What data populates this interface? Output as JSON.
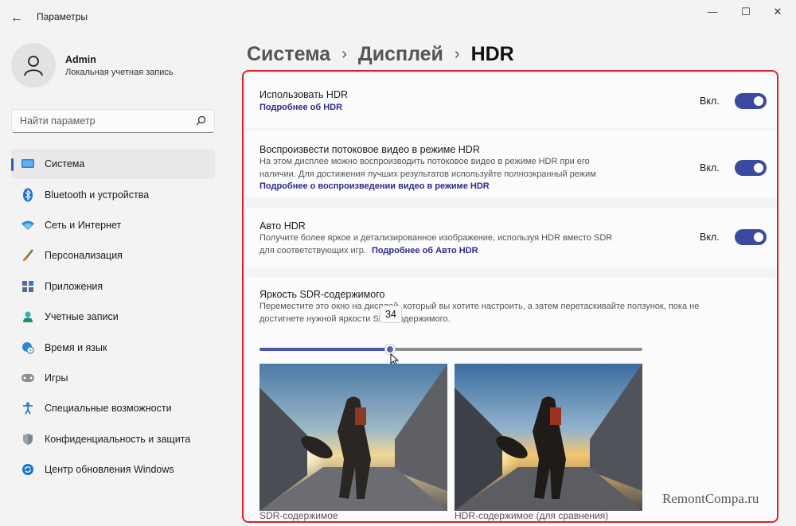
{
  "window": {
    "title": "Параметры",
    "back_icon": "arrow-left-icon",
    "controls": {
      "minimize": "—",
      "maximize": "☐",
      "close": "✕"
    }
  },
  "user": {
    "name": "Admin",
    "account_type": "Локальная учетная запись"
  },
  "search": {
    "placeholder": "Найти параметр"
  },
  "sidebar": {
    "items": [
      {
        "label": "Система",
        "icon": "display-icon",
        "active": true
      },
      {
        "label": "Bluetooth и устройства",
        "icon": "bluetooth-icon"
      },
      {
        "label": "Сеть и Интернет",
        "icon": "wifi-icon"
      },
      {
        "label": "Персонализация",
        "icon": "brush-icon"
      },
      {
        "label": "Приложения",
        "icon": "apps-icon"
      },
      {
        "label": "Учетные записи",
        "icon": "person-icon"
      },
      {
        "label": "Время и язык",
        "icon": "globe-clock-icon"
      },
      {
        "label": "Игры",
        "icon": "gamepad-icon"
      },
      {
        "label": "Специальные возможности",
        "icon": "accessibility-icon"
      },
      {
        "label": "Конфиденциальность и защита",
        "icon": "shield-icon"
      },
      {
        "label": "Центр обновления Windows",
        "icon": "update-icon"
      }
    ]
  },
  "breadcrumb": {
    "parts": [
      "Система",
      "Дисплей"
    ],
    "separator": "›",
    "current": "HDR"
  },
  "settings": {
    "use_hdr": {
      "title": "Использовать HDR",
      "link": "Подробнее об HDR",
      "state": "Вкл.",
      "on": true
    },
    "stream_hdr": {
      "title": "Воспроизвести потоковое видео в режиме HDR",
      "desc_line1": "На этом дисплее можно воспроизводить потоковое видео в режиме HDR при его",
      "desc_line2": "наличии. Для достижения лучших результатов используйте полноэкранный режим",
      "link": "Подробнее о воспроизведении видео в режиме HDR",
      "state": "Вкл.",
      "on": true
    },
    "auto_hdr": {
      "title": "Авто HDR",
      "desc_line1": "Получите более яркое и детализированное изображение, используя HDR вместо SDR",
      "desc_line2": "для соответствующих игр.",
      "link": "Подробнее об Авто HDR",
      "state": "Вкл.",
      "on": true
    },
    "sdr_brightness": {
      "title": "Яркость SDR-содержимого",
      "desc_line1": "Переместите это окно на дисплей, который вы хотите настроить, а затем перетаскивайте ползунок, пока не",
      "desc_line2": "достигнете нужной яркости SDR-содержимого.",
      "value": 34,
      "max": 100,
      "preview_left_caption": "SDR-содержимое",
      "preview_right_caption": "HDR-содержимое (для сравнения)"
    }
  },
  "colors": {
    "accent": "#3b4aa0",
    "highlight_border": "#d9232c"
  },
  "watermark": "RemontCompa.ru"
}
